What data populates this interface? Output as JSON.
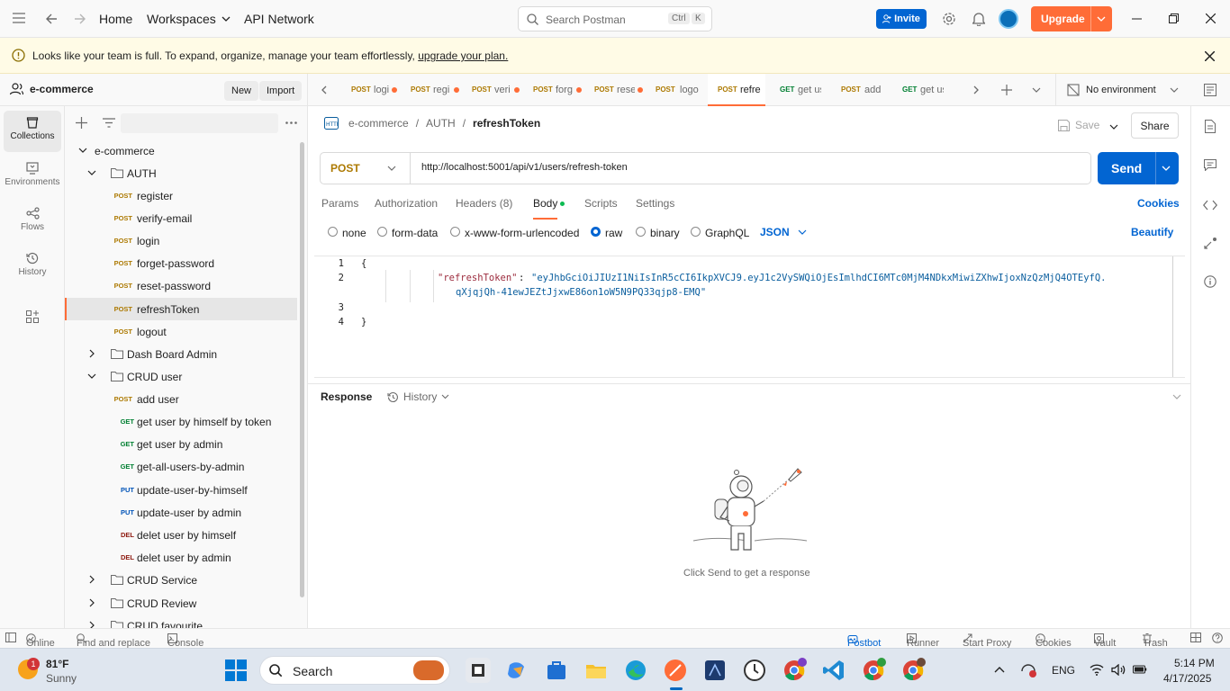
{
  "header": {
    "home": "Home",
    "workspaces": "Workspaces",
    "api_network": "API Network",
    "search_placeholder": "Search Postman",
    "shortcut_ctrl": "Ctrl",
    "shortcut_k": "K",
    "invite": "Invite",
    "upgrade": "Upgrade",
    "accent": "#ff6c37",
    "primary": "#0265d2"
  },
  "banner": {
    "text": "Looks like your team is full. To expand, organize, manage your team effortlessly,",
    "link": "upgrade your plan."
  },
  "workspace": {
    "name": "e-commerce",
    "new": "New",
    "import": "Import"
  },
  "rail": [
    {
      "label": "Collections",
      "icon": "collections-icon"
    },
    {
      "label": "Environments",
      "icon": "environments-icon"
    },
    {
      "label": "Flows",
      "icon": "flows-icon"
    },
    {
      "label": "History",
      "icon": "history-icon"
    }
  ],
  "tree": {
    "collection": "e-commerce",
    "auth_folder": "AUTH",
    "auth_items": [
      {
        "method": "POST",
        "name": "register"
      },
      {
        "method": "POST",
        "name": "verify-email"
      },
      {
        "method": "POST",
        "name": "login"
      },
      {
        "method": "POST",
        "name": "forget-password"
      },
      {
        "method": "POST",
        "name": "reset-password"
      },
      {
        "method": "POST",
        "name": "refreshToken"
      },
      {
        "method": "POST",
        "name": "logout"
      }
    ],
    "dashboard_folder": "Dash Board Admin",
    "crud_user_folder": "CRUD user",
    "crud_user_items": [
      {
        "method": "POST",
        "name": "add user"
      },
      {
        "method": "GET",
        "name": "get user by himself by token"
      },
      {
        "method": "GET",
        "name": "get user by admin"
      },
      {
        "method": "GET",
        "name": "get-all-users-by-admin"
      },
      {
        "method": "PUT",
        "name": "update-user-by-himself"
      },
      {
        "method": "PUT",
        "name": "update-user by admin"
      },
      {
        "method": "DEL",
        "name": "delet user by himself"
      },
      {
        "method": "DEL",
        "name": "delet user by admin"
      }
    ],
    "crud_service_folder": "CRUD Service",
    "crud_review_folder": "CRUD Review",
    "crud_fav_folder": "CRUD favourite"
  },
  "tabs": [
    {
      "method": "POST",
      "title": "logi",
      "dirty": true
    },
    {
      "method": "POST",
      "title": "regi",
      "dirty": true
    },
    {
      "method": "POST",
      "title": "veri",
      "dirty": true
    },
    {
      "method": "POST",
      "title": "forg",
      "dirty": true
    },
    {
      "method": "POST",
      "title": "rese",
      "dirty": true
    },
    {
      "method": "POST",
      "title": "logo",
      "dirty": false
    },
    {
      "method": "POST",
      "title": "refre",
      "dirty": false
    },
    {
      "method": "GET",
      "title": "get us",
      "dirty": false
    },
    {
      "method": "POST",
      "title": "add",
      "dirty": false
    },
    {
      "method": "GET",
      "title": "get us",
      "dirty": false
    }
  ],
  "environment": "No environment",
  "breadcrumb": {
    "collection": "e-commerce",
    "folder": "AUTH",
    "request": "refreshToken",
    "sep": "/"
  },
  "actions": {
    "save": "Save",
    "share": "Share"
  },
  "request": {
    "method": "POST",
    "url": "http://localhost:5001/api/v1/users/refresh-token",
    "send": "Send"
  },
  "request_tabs": [
    "Params",
    "Authorization",
    "Headers (8)",
    "Body",
    "Scripts",
    "Settings"
  ],
  "cookies": "Cookies",
  "body_modes": [
    "none",
    "form-data",
    "x-www-form-urlencoded",
    "raw",
    "binary",
    "GraphQL"
  ],
  "body_format": "JSON",
  "beautify": "Beautify",
  "editor": {
    "lines": [
      "1",
      "2",
      "3",
      "4"
    ],
    "open_brace": "{",
    "close_brace": "}",
    "key": "\"refreshToken\"",
    "colon": ":",
    "value_1": "\"eyJhbGciOiJIUzI1NiIsInR5cCI6IkpXVCJ9.eyJ1c2VySWQiOjEsImlhdCI6MTc0MjM4NDkxMiwiZXhwIjoxNzQzMjQ4OTEyfQ.",
    "value_2": "qXjqjQh-41ewJEZtJjxwE86on1oW5N9PQ33qjp8-EMQ\""
  },
  "response": {
    "title": "Response",
    "history": "History",
    "empty": "Click Send to get a response"
  },
  "status": {
    "online": "Online",
    "find": "Find and replace",
    "console": "Console",
    "postbot": "Postbot",
    "runner": "Runner",
    "proxy": "Start Proxy",
    "cookies": "Cookies",
    "vault": "Vault",
    "trash": "Trash"
  },
  "taskbar": {
    "temp": "81°F",
    "weather": "Sunny",
    "weather_badge": "1",
    "search": "Search",
    "lang": "ENG",
    "time": "5:14 PM",
    "date": "4/17/2025"
  }
}
